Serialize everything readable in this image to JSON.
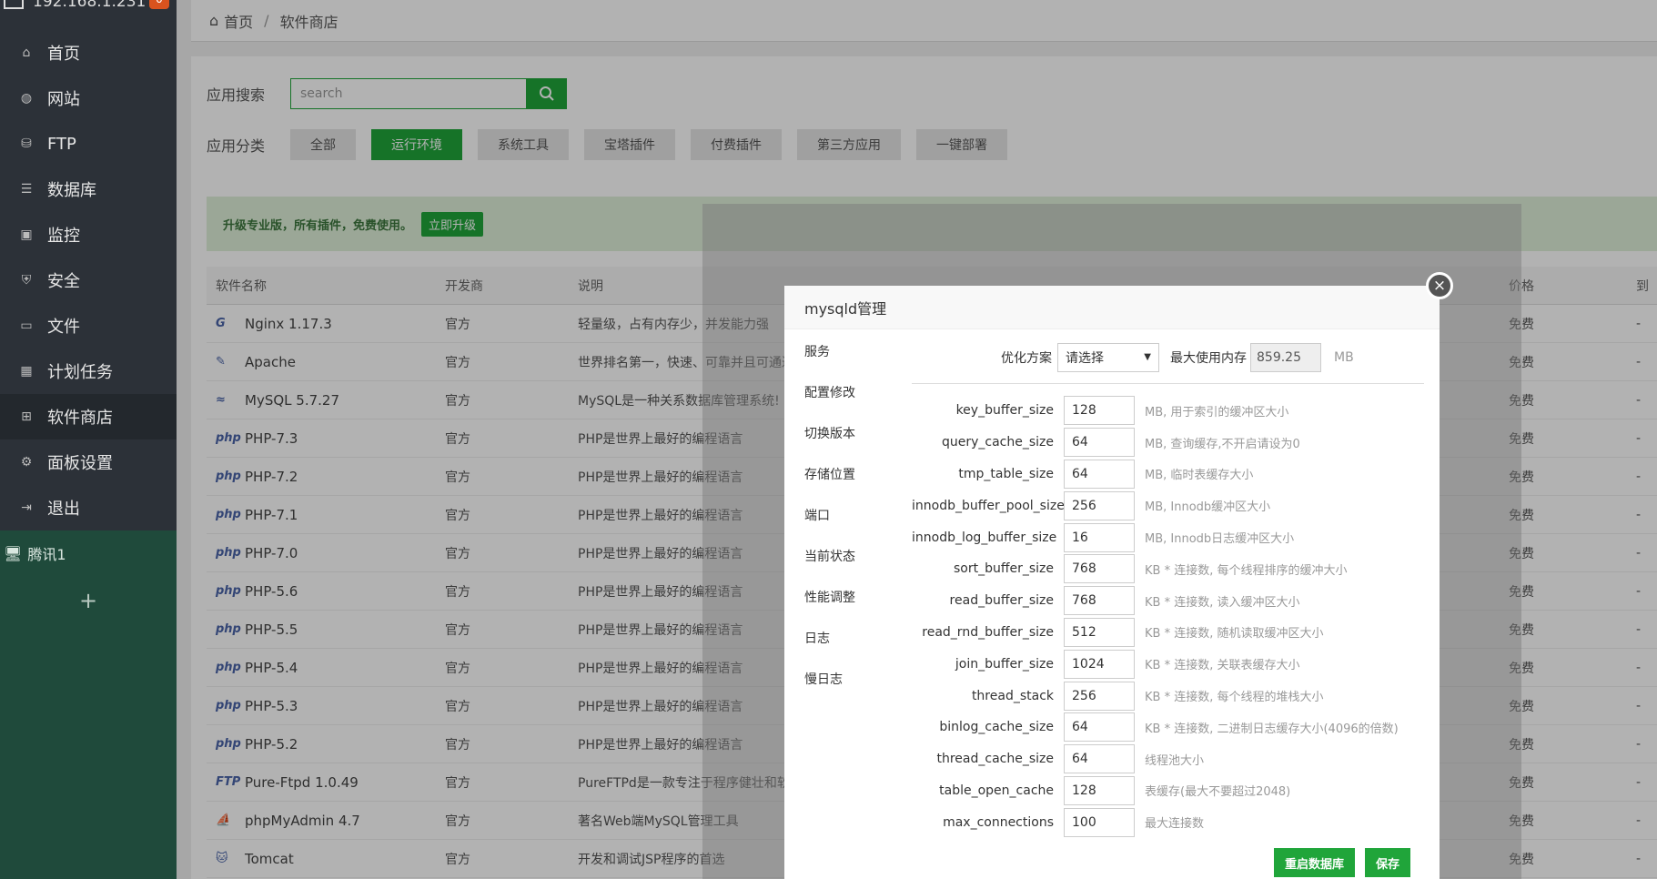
{
  "sidebar": {
    "ip": "192.168.1.231",
    "badge": "0",
    "items": [
      {
        "label": "首页",
        "icon": "home-icon"
      },
      {
        "label": "网站",
        "icon": "globe-icon"
      },
      {
        "label": "FTP",
        "icon": "ftp-icon"
      },
      {
        "label": "数据库",
        "icon": "database-icon"
      },
      {
        "label": "监控",
        "icon": "monitor-icon"
      },
      {
        "label": "安全",
        "icon": "shield-icon"
      },
      {
        "label": "文件",
        "icon": "folder-icon"
      },
      {
        "label": "计划任务",
        "icon": "calendar-icon"
      },
      {
        "label": "软件商店",
        "icon": "grid-icon"
      },
      {
        "label": "面板设置",
        "icon": "gear-icon"
      },
      {
        "label": "退出",
        "icon": "logout-icon"
      }
    ],
    "server": "腾讯1",
    "add": "+"
  },
  "breadcrumb": {
    "home": "首页",
    "sep": "/",
    "current": "软件商店"
  },
  "search": {
    "label": "应用搜索",
    "placeholder": "search"
  },
  "categories": {
    "label": "应用分类",
    "items": [
      "全部",
      "运行环境",
      "系统工具",
      "宝塔插件",
      "付费插件",
      "第三方应用",
      "一键部署"
    ]
  },
  "promo": {
    "text": "升级专业版，所有插件，免费使用。",
    "button": "立即升级"
  },
  "table": {
    "headers": [
      "软件名称",
      "开发商",
      "说明",
      "价格",
      "到"
    ],
    "rows": [
      {
        "logo": "G",
        "name": "Nginx 1.17.3",
        "dev": "官方",
        "desc": "轻量级，占有内存少，并发能力强",
        "price": "免费",
        "exp": "-"
      },
      {
        "logo": "✎",
        "name": "Apache",
        "dev": "官方",
        "desc": "世界排名第一，快速、可靠并且可通过简单的API扩充",
        "price": "免费",
        "exp": "-"
      },
      {
        "logo": "≈",
        "name": "MySQL 5.7.27",
        "dev": "官方",
        "desc": "MySQL是一种关系数据库管理系统!",
        "price": "免费",
        "exp": "-"
      },
      {
        "logo": "php",
        "name": "PHP-7.3",
        "dev": "官方",
        "desc": "PHP是世界上最好的编程语言",
        "price": "免费",
        "exp": "-"
      },
      {
        "logo": "php",
        "name": "PHP-7.2",
        "dev": "官方",
        "desc": "PHP是世界上最好的编程语言",
        "price": "免费",
        "exp": "-"
      },
      {
        "logo": "php",
        "name": "PHP-7.1",
        "dev": "官方",
        "desc": "PHP是世界上最好的编程语言",
        "price": "免费",
        "exp": "-"
      },
      {
        "logo": "php",
        "name": "PHP-7.0",
        "dev": "官方",
        "desc": "PHP是世界上最好的编程语言",
        "price": "免费",
        "exp": "-"
      },
      {
        "logo": "php",
        "name": "PHP-5.6",
        "dev": "官方",
        "desc": "PHP是世界上最好的编程语言",
        "price": "免费",
        "exp": "-"
      },
      {
        "logo": "php",
        "name": "PHP-5.5",
        "dev": "官方",
        "desc": "PHP是世界上最好的编程语言",
        "price": "免费",
        "exp": "-"
      },
      {
        "logo": "php",
        "name": "PHP-5.4",
        "dev": "官方",
        "desc": "PHP是世界上最好的编程语言",
        "price": "免费",
        "exp": "-"
      },
      {
        "logo": "php",
        "name": "PHP-5.3",
        "dev": "官方",
        "desc": "PHP是世界上最好的编程语言",
        "price": "免费",
        "exp": "-"
      },
      {
        "logo": "php",
        "name": "PHP-5.2",
        "dev": "官方",
        "desc": "PHP是世界上最好的编程语言",
        "price": "免费",
        "exp": "-"
      },
      {
        "logo": "FTP",
        "name": "Pure-Ftpd 1.0.49",
        "dev": "官方",
        "desc": "PureFTPd是一款专注于程序健壮和软件安全的免费FTP服",
        "price": "免费",
        "exp": "-"
      },
      {
        "logo": "⛵",
        "name": "phpMyAdmin 4.7",
        "dev": "官方",
        "desc": "著名Web端MySQL管理工具",
        "price": "免费",
        "exp": "-"
      },
      {
        "logo": "🐱",
        "name": "Tomcat",
        "dev": "官方",
        "desc": "开发和调试JSP程序的首选",
        "price": "免费",
        "exp": "-"
      }
    ]
  },
  "dialog": {
    "title": "mysqld管理",
    "menu": [
      "服务",
      "配置修改",
      "切换版本",
      "存储位置",
      "端口",
      "当前状态",
      "性能调整",
      "日志",
      "慢日志"
    ],
    "optimize_label": "优化方案",
    "optimize_value": "请选择",
    "max_mem_label": "最大使用内存",
    "max_mem_value": "859.25",
    "max_mem_unit": "MB",
    "params": [
      {
        "key": "key_buffer_size",
        "value": "128",
        "desc": "MB, 用于索引的缓冲区大小"
      },
      {
        "key": "query_cache_size",
        "value": "64",
        "desc": "MB, 查询缓存,不开启请设为0"
      },
      {
        "key": "tmp_table_size",
        "value": "64",
        "desc": "MB, 临时表缓存大小"
      },
      {
        "key": "innodb_buffer_pool_size",
        "value": "256",
        "desc": "MB, Innodb缓冲区大小"
      },
      {
        "key": "innodb_log_buffer_size",
        "value": "16",
        "desc": "MB, Innodb日志缓冲区大小"
      },
      {
        "key": "sort_buffer_size",
        "value": "768",
        "desc": "KB * 连接数, 每个线程排序的缓冲大小"
      },
      {
        "key": "read_buffer_size",
        "value": "768",
        "desc": "KB * 连接数, 读入缓冲区大小"
      },
      {
        "key": "read_rnd_buffer_size",
        "value": "512",
        "desc": "KB * 连接数, 随机读取缓冲区大小"
      },
      {
        "key": "join_buffer_size",
        "value": "1024",
        "desc": "KB * 连接数, 关联表缓存大小"
      },
      {
        "key": "thread_stack",
        "value": "256",
        "desc": "KB * 连接数, 每个线程的堆栈大小"
      },
      {
        "key": "binlog_cache_size",
        "value": "64",
        "desc": "KB * 连接数, 二进制日志缓存大小(4096的倍数)"
      },
      {
        "key": "thread_cache_size",
        "value": "64",
        "desc": "线程池大小"
      },
      {
        "key": "table_open_cache",
        "value": "128",
        "desc": "表缓存(最大不要超过2048)"
      },
      {
        "key": "max_connections",
        "value": "100",
        "desc": "最大连接数"
      }
    ],
    "restart_button": "重启数据库",
    "save_button": "保存",
    "close_icon": "×"
  }
}
